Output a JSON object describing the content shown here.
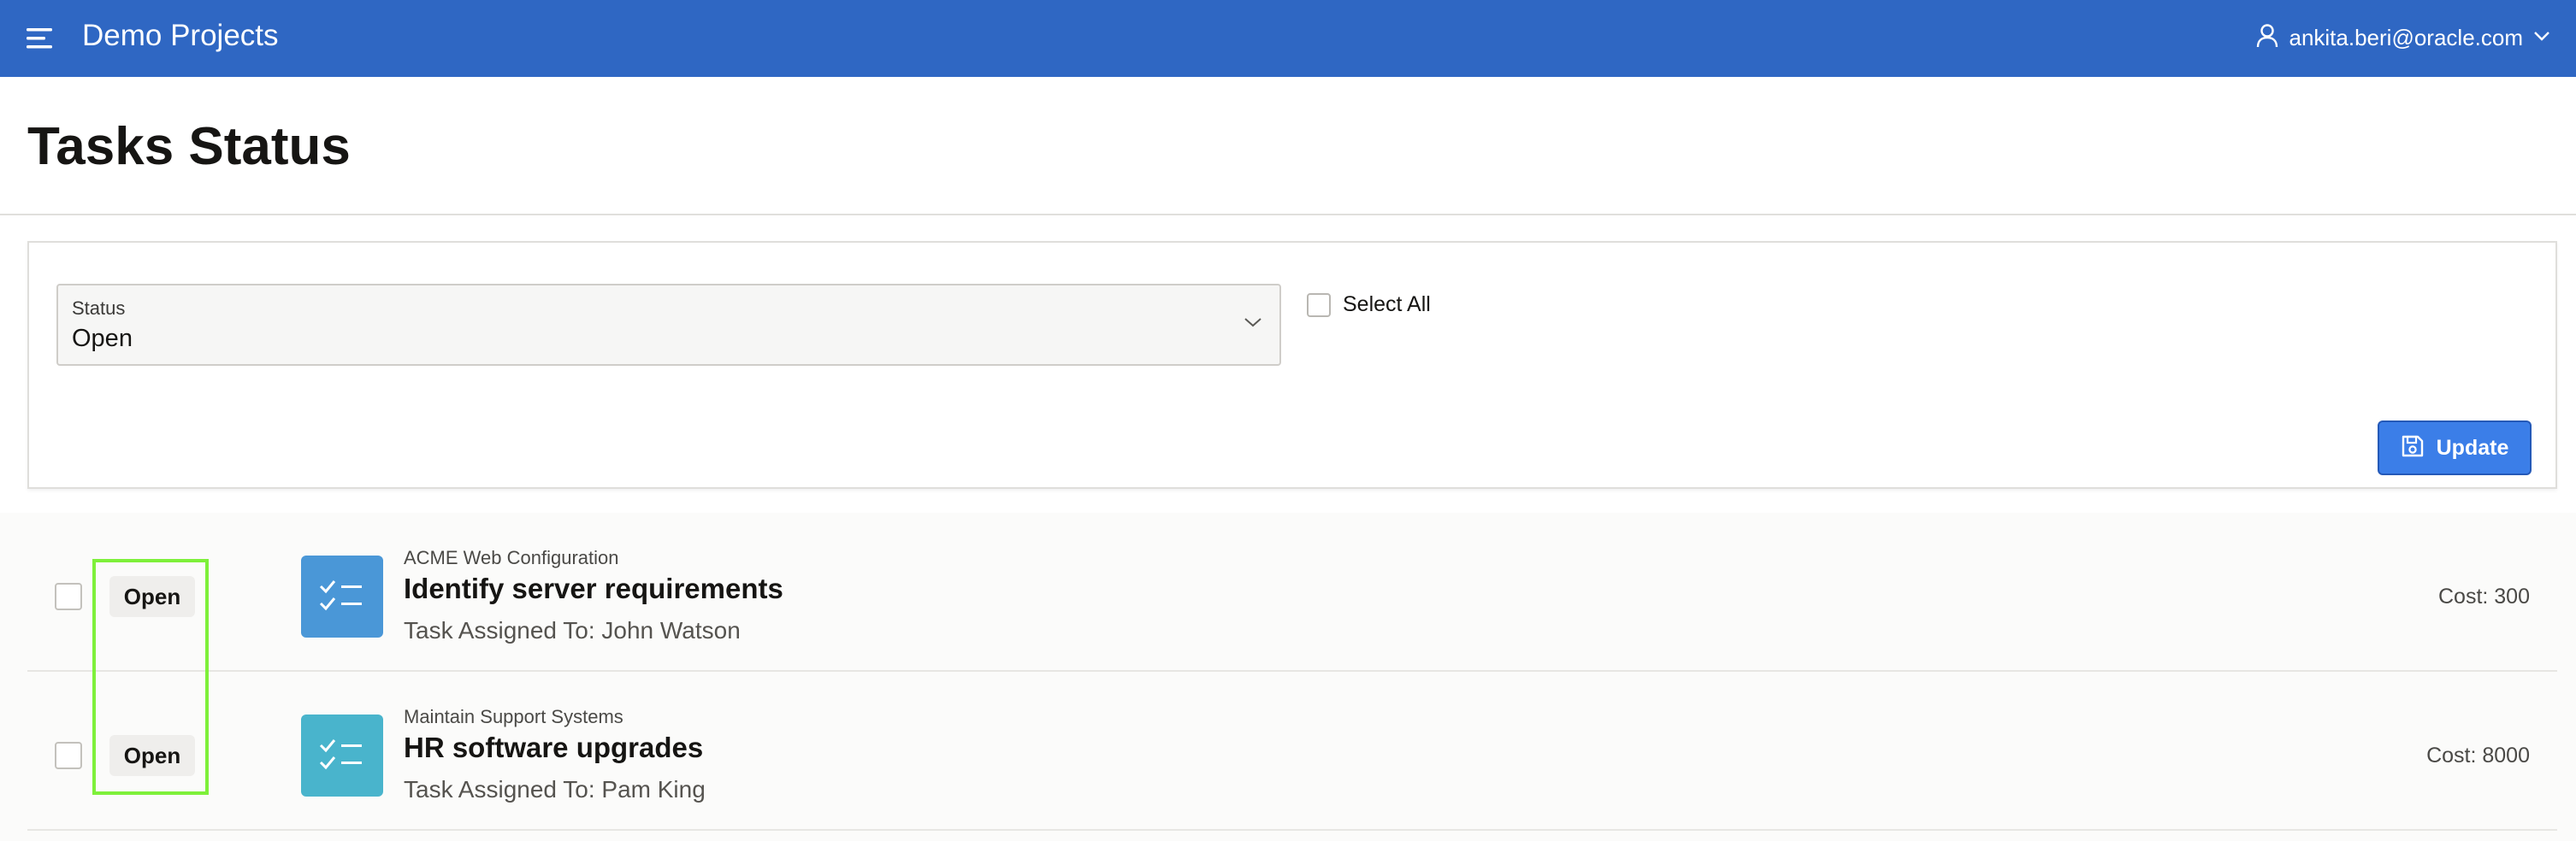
{
  "header": {
    "app_title": "Demo Projects",
    "menu_icon": "hamburger-menu-icon",
    "user_icon": "user-icon",
    "user_email": "ankita.beri@oracle.com",
    "user_chevron": "chevron-down-icon",
    "background_color": "#2f67c3"
  },
  "page": {
    "title": "Tasks Status"
  },
  "form": {
    "status_label": "Status",
    "status_value": "Open",
    "select_all_label": "Select All",
    "select_all_checked": false,
    "update_label": "Update",
    "update_icon": "save-icon",
    "update_color": "#3b7ee8"
  },
  "tasks": [
    {
      "checked": false,
      "status": "Open",
      "icon": "checklist-icon",
      "icon_color": "#4a97d7",
      "project": "ACME Web Configuration",
      "name": "Identify server requirements",
      "assigned": "Task Assigned To: John Watson",
      "cost": "Cost: 300"
    },
    {
      "checked": false,
      "status": "Open",
      "icon": "checklist-icon",
      "icon_color": "#49b4cc",
      "project": "Maintain Support Systems",
      "name": "HR software upgrades",
      "assigned": "Task Assigned To: Pam King",
      "cost": "Cost: 8000"
    }
  ],
  "highlight_color": "#7ef03a"
}
